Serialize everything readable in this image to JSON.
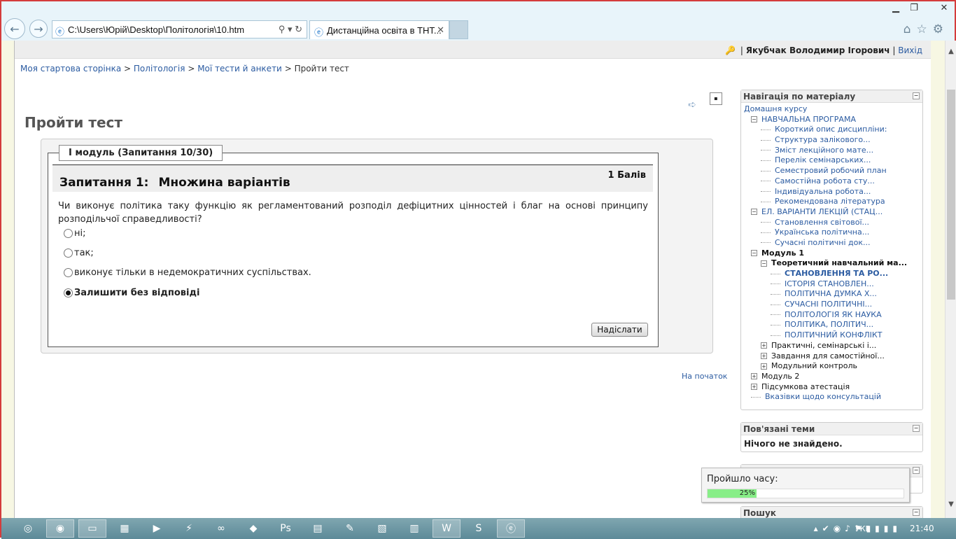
{
  "browser": {
    "address": "C:\\Users\\Юрій\\Desktop\\Політологія\\10.htm",
    "tab_title": "Дистанційна освіта в ТНТ...",
    "window_controls": [
      "minimize",
      "maximize",
      "close"
    ],
    "right_icons": [
      "home-icon",
      "star-icon",
      "gear-icon"
    ]
  },
  "userbar": {
    "name": "Якубчак Володимир Ігорович",
    "logout": "Вихід",
    "separator": "|"
  },
  "breadcrumb": {
    "items": [
      "Моя стартова сторінка",
      "Політологія",
      "Мої тести й анкети"
    ],
    "current": "Пройти тест",
    "sep": ">"
  },
  "page_title": "Пройти тест",
  "quiz": {
    "legend": "I модуль (Запитання 10/30)",
    "question_number": "Запитання 1:",
    "question_type": "Множина варіантів",
    "marks": "1 Балів",
    "question_text": "Чи виконує політика таку функцію як регламентований розподіл дефіцитних цінностей і благ на основі принципу розподільчої справедливості?",
    "options": [
      {
        "label": "ні;",
        "selected": false
      },
      {
        "label": "так;",
        "selected": false
      },
      {
        "label": "виконує тільки в недемократичних суспільствах.",
        "selected": false
      },
      {
        "label": "Залишити без відповіді",
        "selected": true
      }
    ],
    "submit": "Надіслати"
  },
  "to_top": "На початок",
  "navigation": {
    "title": "Навігація по матеріалу",
    "items": [
      {
        "label": "Домашня курсу",
        "level": 0,
        "style": "lnk",
        "box": ""
      },
      {
        "label": "НАВЧАЛЬНА ПРОГРАМА",
        "level": 1,
        "style": "lnk",
        "box": "−"
      },
      {
        "label": "Короткий опис дисципліни:",
        "level": 2,
        "style": "lnk",
        "box": "dots"
      },
      {
        "label": "Структура залікового...",
        "level": 2,
        "style": "lnk",
        "box": "dots"
      },
      {
        "label": "Зміст лекційного мате...",
        "level": 2,
        "style": "lnk",
        "box": "dots"
      },
      {
        "label": "Перелік семінарських...",
        "level": 2,
        "style": "lnk",
        "box": "dots"
      },
      {
        "label": "Семестровий робочий план",
        "level": 2,
        "style": "lnk",
        "box": "dots"
      },
      {
        "label": "Самостійна робота сту...",
        "level": 2,
        "style": "lnk",
        "box": "dots"
      },
      {
        "label": "Індивідуальна робота...",
        "level": 2,
        "style": "lnk",
        "box": "dots"
      },
      {
        "label": "Рекомендована література",
        "level": 2,
        "style": "lnk",
        "box": "dots"
      },
      {
        "label": "ЕЛ. ВАРІАНТИ ЛЕКЦІЙ (СТАЦ...",
        "level": 1,
        "style": "lnk",
        "box": "−"
      },
      {
        "label": "Становлення світової...",
        "level": 2,
        "style": "lnk",
        "box": "dots"
      },
      {
        "label": "Українська політична...",
        "level": 2,
        "style": "lnk",
        "box": "dots"
      },
      {
        "label": "Сучасні політичні док...",
        "level": 2,
        "style": "lnk",
        "box": "dots"
      },
      {
        "label": "Модуль 1",
        "level": 1,
        "style": "bold",
        "box": "−"
      },
      {
        "label": "Теоретичний навчальний ма...",
        "level": 2,
        "style": "bold",
        "box": "−"
      },
      {
        "label": "СТАНОВЛЕННЯ ТА РО...",
        "level": 3,
        "style": "cur",
        "box": "dots"
      },
      {
        "label": "ІСТОРІЯ СТАНОВЛЕН...",
        "level": 3,
        "style": "lnk",
        "box": "dots"
      },
      {
        "label": "ПОЛІТИЧНА ДУМКА Х...",
        "level": 3,
        "style": "lnk",
        "box": "dots"
      },
      {
        "label": "СУЧАСНІ ПОЛІТИЧНІ...",
        "level": 3,
        "style": "lnk",
        "box": "dots"
      },
      {
        "label": "ПОЛІТОЛОГІЯ ЯК НАУКА",
        "level": 3,
        "style": "lnk",
        "box": "dots"
      },
      {
        "label": "ПОЛІТИКА, ПОЛІТИЧ...",
        "level": 3,
        "style": "lnk",
        "box": "dots"
      },
      {
        "label": "ПОЛІТИЧНИЙ КОНФЛІКТ",
        "level": 3,
        "style": "lnk",
        "box": "dots"
      },
      {
        "label": "Практичні, семінарські і...",
        "level": 2,
        "style": "plain",
        "box": "+"
      },
      {
        "label": "Завдання для самостійної...",
        "level": 2,
        "style": "plain",
        "box": "+"
      },
      {
        "label": "Модульний контроль",
        "level": 2,
        "style": "plain",
        "box": "+"
      },
      {
        "label": "Модуль 2",
        "level": 1,
        "style": "plain",
        "box": "+"
      },
      {
        "label": "Підсумкова атестація",
        "level": 1,
        "style": "plain",
        "box": "+"
      },
      {
        "label": "Вказівки щодо консультацій",
        "level": 1,
        "style": "lnk",
        "box": "dots"
      }
    ]
  },
  "related": {
    "title": "Пов'язані теми",
    "empty": "Нічого не знайдено."
  },
  "timer": {
    "label": "Пройшло часу:",
    "progress": 0.25,
    "progress_text": "25%"
  },
  "search_block": {
    "title": "Пошук"
  },
  "taskbar": {
    "language": "УКР",
    "clock": "21:40"
  }
}
